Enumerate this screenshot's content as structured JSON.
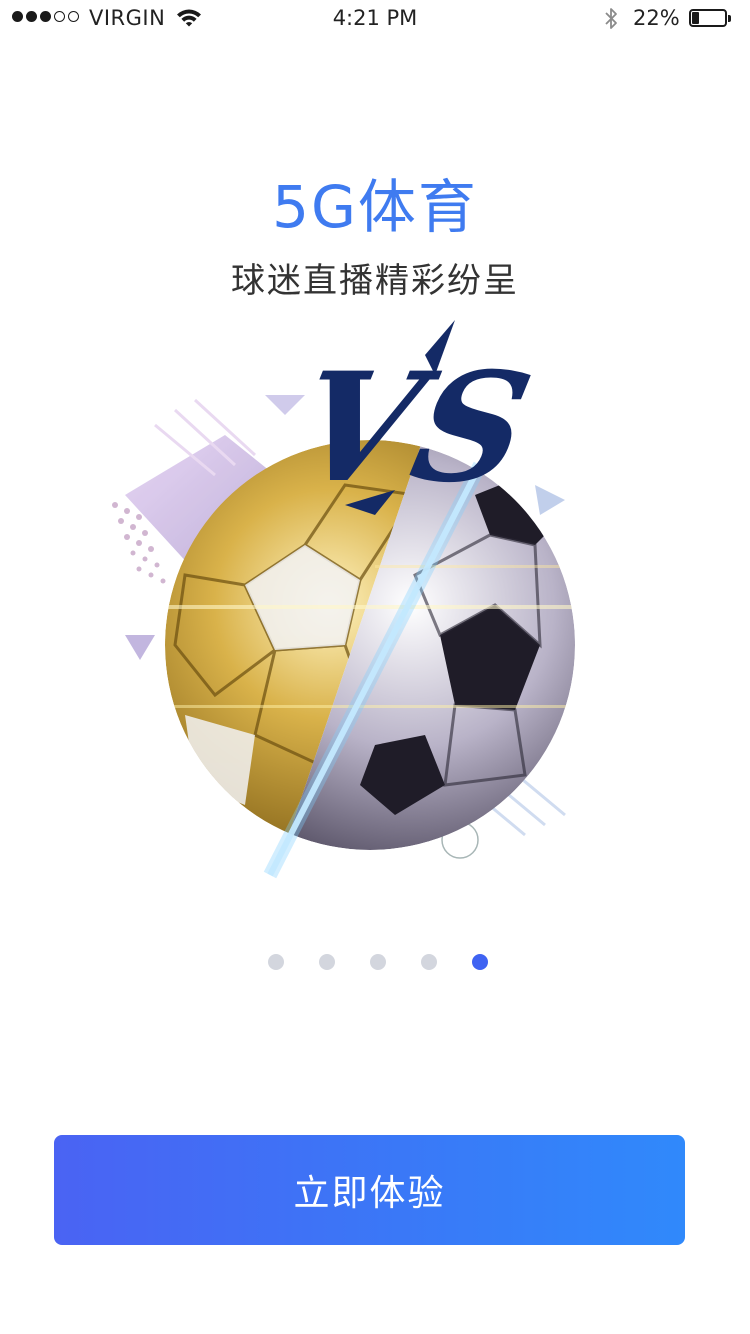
{
  "status_bar": {
    "carrier": "VIRGIN",
    "time": "4:21 PM",
    "battery_percent": "22%",
    "battery_level": 0.22,
    "signal_bars": 3,
    "signal_total": 5
  },
  "content": {
    "title": "5G体育",
    "subtitle": "球迷直播精彩纷呈",
    "illustration_text": "VS"
  },
  "pager": {
    "total": 5,
    "active_index": 4
  },
  "cta": {
    "label": "立即体验"
  },
  "colors": {
    "accent": "#3f7bf0",
    "button_start": "#4a63f3",
    "button_end": "#3089fb",
    "pager_active": "#3f63f2",
    "pager_inactive": "#d3d6de"
  }
}
